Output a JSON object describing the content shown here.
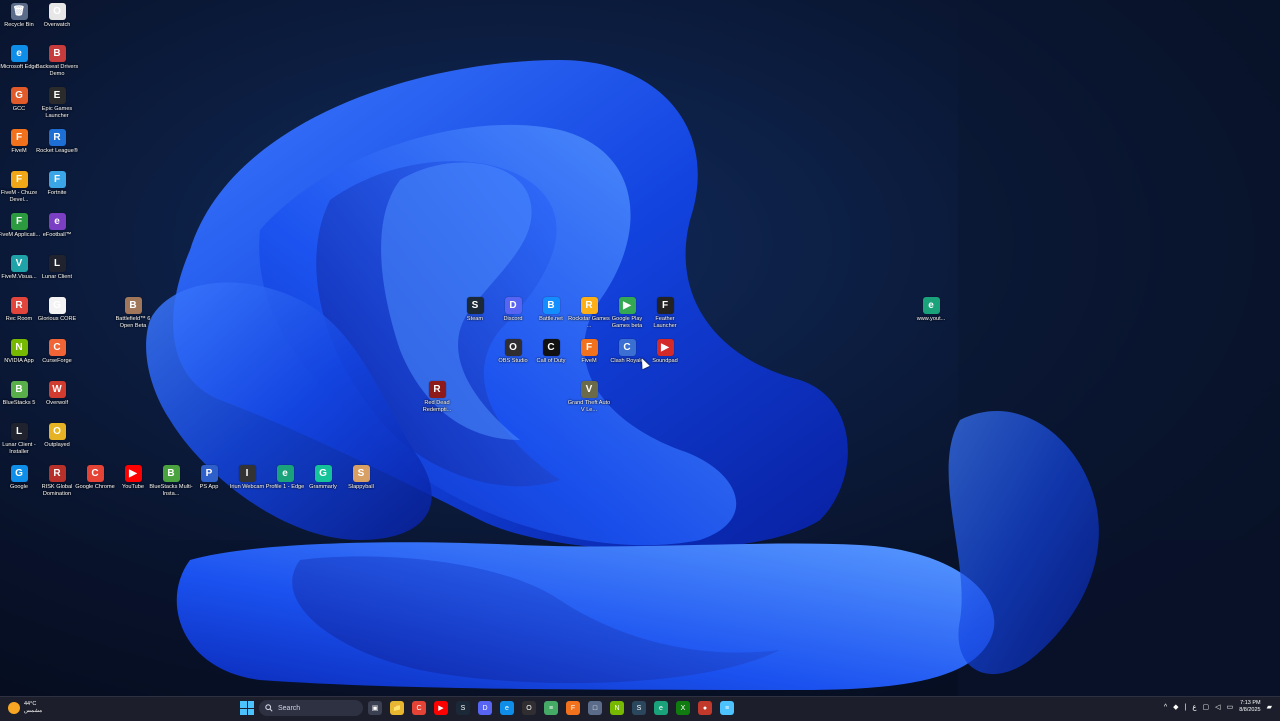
{
  "desktop": {
    "icons": [
      {
        "label": "Recycle Bin",
        "glyph": "🗑",
        "color": "#5a6c8a"
      },
      {
        "label": "Overwatch",
        "glyph": "O",
        "color": "#e7e7e7"
      },
      {
        "label": "Microsoft Edge",
        "glyph": "e",
        "color": "#0e8ee9"
      },
      {
        "label": "Backseat Drivers Demo",
        "glyph": "B",
        "color": "#c63b3b"
      },
      {
        "label": "GCC",
        "glyph": "G",
        "color": "#e15a2a"
      },
      {
        "label": "Epic Games Launcher",
        "glyph": "E",
        "color": "#2b2b2b"
      },
      {
        "label": "FiveM",
        "glyph": "F",
        "color": "#f2711c"
      },
      {
        "label": "Rocket League®",
        "glyph": "R",
        "color": "#1d6fd6"
      },
      {
        "label": "FiveM - Chuze Devel...",
        "glyph": "F",
        "color": "#f0a818"
      },
      {
        "label": "Fortnite",
        "glyph": "F",
        "color": "#3aa6e8"
      },
      {
        "label": "FiveM Applicati...",
        "glyph": "F",
        "color": "#2c9a3f"
      },
      {
        "label": "eFootball™",
        "glyph": "e",
        "color": "#7b3fc4"
      },
      {
        "label": "FiveM.Visua...",
        "glyph": "V",
        "color": "#1fa3a8"
      },
      {
        "label": "Lunar Client",
        "glyph": "L",
        "color": "#20232e"
      },
      {
        "label": "Rec Room",
        "glyph": "R",
        "color": "#e2453c"
      },
      {
        "label": "Glorious CORE",
        "glyph": "G",
        "color": "#f3f3f3"
      },
      {
        "label": "Battlefield™ 6 Open Beta",
        "glyph": "B",
        "color": "#a0775a"
      },
      {
        "label": "NVIDIA App",
        "glyph": "N",
        "color": "#76b900"
      },
      {
        "label": "CurseForge",
        "glyph": "C",
        "color": "#f16436"
      },
      {
        "label": "BlueStacks 5",
        "glyph": "B",
        "color": "#59b04a"
      },
      {
        "label": "Overwolf",
        "glyph": "W",
        "color": "#d23b30"
      },
      {
        "label": "Lunar Client - Installer",
        "glyph": "L",
        "color": "#20232e"
      },
      {
        "label": "Outplayed",
        "glyph": "O",
        "color": "#e5b323"
      },
      {
        "label": "Google",
        "glyph": "G",
        "color": "#0e8ee9"
      },
      {
        "label": "RISK Global Domination",
        "glyph": "R",
        "color": "#b8302a"
      },
      {
        "label": "Google Chrome",
        "glyph": "C",
        "color": "#e54335"
      },
      {
        "label": "YouTube",
        "glyph": "▶",
        "color": "#ff0000"
      },
      {
        "label": "BlueStacks Multi-Insta...",
        "glyph": "B",
        "color": "#4aa33e"
      },
      {
        "label": "PS App",
        "glyph": "P",
        "color": "#2f5fc9"
      },
      {
        "label": "Iriun Webcam",
        "glyph": "I",
        "color": "#333"
      },
      {
        "label": "Profile 1 - Edge",
        "glyph": "e",
        "color": "#1aa37a"
      },
      {
        "label": "Grammarly",
        "glyph": "G",
        "color": "#15c39a"
      },
      {
        "label": "Slappyball",
        "glyph": "S",
        "color": "#d9a066"
      },
      {
        "label": "Steam",
        "glyph": "S",
        "color": "#1b2838"
      },
      {
        "label": "Discord",
        "glyph": "D",
        "color": "#5865f2"
      },
      {
        "label": "Battle.net",
        "glyph": "B",
        "color": "#148eff"
      },
      {
        "label": "Rockstar Games ...",
        "glyph": "R",
        "color": "#fcaf17"
      },
      {
        "label": "Google Play Games beta",
        "glyph": "▶",
        "color": "#34a853"
      },
      {
        "label": "Feather Launcher",
        "glyph": "F",
        "color": "#222"
      },
      {
        "label": "OBS Studio",
        "glyph": "O",
        "color": "#302e31"
      },
      {
        "label": "Call of Duty",
        "glyph": "C",
        "color": "#111"
      },
      {
        "label": "FiveM",
        "glyph": "F",
        "color": "#f2711c"
      },
      {
        "label": "Clash Royale",
        "glyph": "C",
        "color": "#3b6fd1"
      },
      {
        "label": "Soundpad",
        "glyph": "▶",
        "color": "#d42a2a"
      },
      {
        "label": "Red Dead Redempti...",
        "glyph": "R",
        "color": "#8e1a1a"
      },
      {
        "label": "Grand Theft Auto V Le...",
        "glyph": "V",
        "color": "#6b6b4a"
      },
      {
        "label": "www.yout...",
        "glyph": "e",
        "color": "#1aa37a"
      }
    ]
  },
  "taskbar": {
    "weather": {
      "temp": "44°C",
      "note": "مشمس"
    },
    "search_label": "Search",
    "apps": [
      {
        "name": "task-view",
        "glyph": "▣",
        "color": "#3a3f52"
      },
      {
        "name": "file-explorer",
        "glyph": "📁",
        "color": "#e8b730"
      },
      {
        "name": "chrome",
        "glyph": "C",
        "color": "#e54335"
      },
      {
        "name": "youtube",
        "glyph": "▶",
        "color": "#ff0000"
      },
      {
        "name": "steam",
        "glyph": "S",
        "color": "#1b2838"
      },
      {
        "name": "discord",
        "glyph": "D",
        "color": "#5865f2"
      },
      {
        "name": "edge",
        "glyph": "e",
        "color": "#0e8ee9"
      },
      {
        "name": "obs",
        "glyph": "O",
        "color": "#302e31"
      },
      {
        "name": "notepad",
        "glyph": "≡",
        "color": "#4a6"
      },
      {
        "name": "fivem",
        "glyph": "F",
        "color": "#f2711c"
      },
      {
        "name": "document",
        "glyph": "□",
        "color": "#5a6c8a"
      },
      {
        "name": "nvidia",
        "glyph": "N",
        "color": "#76b900"
      },
      {
        "name": "steam-2",
        "glyph": "S",
        "color": "#2a475e"
      },
      {
        "name": "edge-2",
        "glyph": "e",
        "color": "#1aa37a"
      },
      {
        "name": "xbox",
        "glyph": "X",
        "color": "#107c10"
      },
      {
        "name": "record",
        "glyph": "●",
        "color": "#c0392b"
      },
      {
        "name": "notes",
        "glyph": "≡",
        "color": "#4cc2ff"
      }
    ],
    "tray": {
      "time": "7:13 PM",
      "date": "8/8/2025"
    }
  }
}
